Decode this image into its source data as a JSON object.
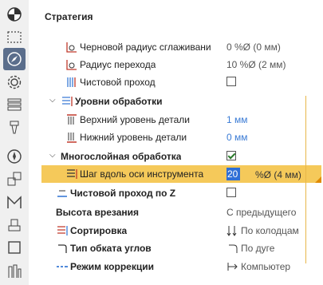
{
  "section_title": "Стратегия",
  "rows": {
    "rough_radius": {
      "label": "Черновой радиус сглаживани",
      "value": "0 %Ø (0 мм)"
    },
    "transition_radius": {
      "label": "Радиус перехода",
      "value": "10 %Ø (2 мм)"
    },
    "finish_pass": {
      "label": "Чистовой проход"
    },
    "levels": {
      "label": "Уровни обработки"
    },
    "top_level": {
      "label": "Верхний уровень детали",
      "value": "1 мм"
    },
    "bottom_level": {
      "label": "Нижний уровень детали",
      "value": "0 мм"
    },
    "multilayer": {
      "label": "Многослойная обработка"
    },
    "step_axis": {
      "label": "Шаг вдоль оси инструмента",
      "input": "20",
      "value": "%Ø (4 мм)"
    },
    "finish_z": {
      "label": "Чистовой проход по Z"
    },
    "plunge_height": {
      "label": "Высота врезания",
      "value": "С предыдущего"
    },
    "sorting": {
      "label": "Сортировка",
      "value": "По колодцам"
    },
    "corner_type": {
      "label": "Тип обката углов",
      "value": "По дуге"
    },
    "correction": {
      "label": "Режим коррекции",
      "value": "Компьютер"
    }
  },
  "state": {
    "finish_pass_checked": false,
    "multilayer_checked": true,
    "finish_z_checked": false
  },
  "colors": {
    "highlight": "#f5c95a",
    "value_blue": "#3a7bd5",
    "sidebar_active": "#5b6e8c",
    "edit_selection": "#2f6fd6"
  },
  "sidebar_icons": [
    "pie-chart-icon",
    "dashed-rectangle-icon",
    "compass-icon",
    "gear-icon",
    "layers-icon",
    "drill-bit-icon",
    "dial-icon",
    "shapes-icon",
    "letter-m-icon",
    "stamp-icon",
    "square-icon",
    "toolpath-icon"
  ]
}
